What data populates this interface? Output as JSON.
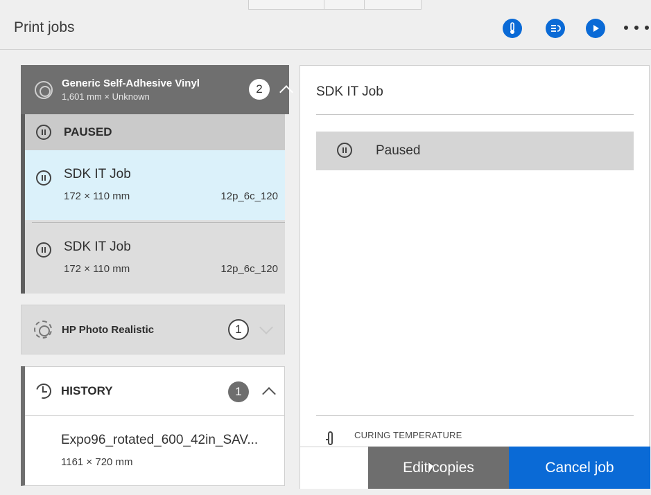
{
  "header": {
    "title": "Print jobs",
    "icons": [
      "thermometer-icon",
      "queue-list-icon",
      "play-icon",
      "more-icon"
    ]
  },
  "queues": {
    "vinyl": {
      "name": "Generic Self-Adhesive Vinyl",
      "subtitle": "1,601 mm × Unknown",
      "count": "2",
      "paused_label": "PAUSED",
      "jobs": [
        {
          "name": "SDK IT Job",
          "size": "172 × 110 mm",
          "mode": "12p_6c_120"
        },
        {
          "name": "SDK IT Job",
          "size": "172 × 110 mm",
          "mode": "12p_6c_120"
        }
      ]
    },
    "photo": {
      "name": "HP Photo Realistic",
      "count": "1"
    }
  },
  "history": {
    "label": "HISTORY",
    "count": "1",
    "items": [
      {
        "name": "Expo96_rotated_600_42in_SAV...",
        "size": "1161 × 720 mm"
      }
    ]
  },
  "detail": {
    "title": "SDK IT Job",
    "status": "Paused",
    "curing_label": "CURING TEMPERATURE",
    "edit_copies": "Edit copies",
    "cancel_job": "Cancel job"
  },
  "colors": {
    "accent": "#0a6ad6",
    "selected_row": "#dbf1fa",
    "queue_header": "#6f6f6f"
  }
}
